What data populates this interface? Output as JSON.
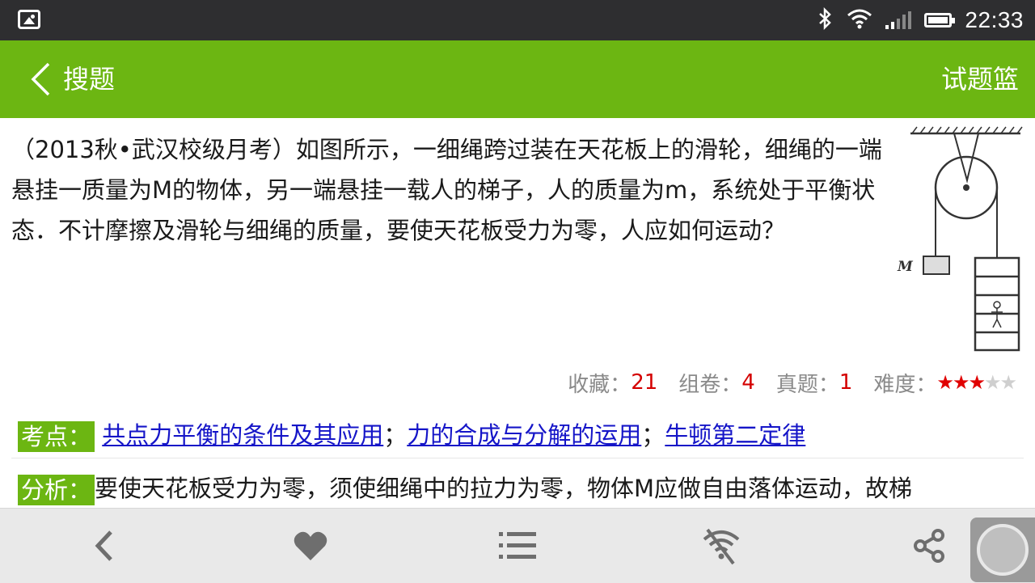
{
  "status_bar": {
    "time": "22:33"
  },
  "top_bar": {
    "back_label": "搜题",
    "right_label": "试题篮"
  },
  "question": {
    "text": "（2013秋•武汉校级月考）如图所示，一细绳跨过装在天花板上的滑轮，细绳的一端悬挂一质量为M的物体，另一端悬挂一载人的梯子，人的质量为m，系统处于平衡状态．不计摩擦及滑轮与细绳的质量，要使天花板受力为零，人应如何运动？",
    "diagram_label": "M"
  },
  "meta": {
    "collect_label": "收藏：",
    "collect_count": "21",
    "compose_label": "组卷：",
    "compose_count": "4",
    "real_label": "真题：",
    "real_count": "1",
    "difficulty_label": "难度：",
    "difficulty_stars": 3,
    "difficulty_max": 5
  },
  "kaodian": {
    "label": "考点：",
    "links": [
      "共点力平衡的条件及其应用",
      "力的合成与分解的运用",
      "牛顿第二定律"
    ],
    "separator": "；"
  },
  "fenxi": {
    "label": "分析：",
    "text": "要使天花板受力为零，须使细绳中的拉力为零，物体M应做自由落体运动，故梯"
  },
  "bottom_bar": {
    "icons": [
      "back-icon",
      "heart-icon",
      "list-icon",
      "no-wifi-icon",
      "share-icon"
    ]
  },
  "colors": {
    "primary_green": "#6cb612",
    "link_blue": "#1515c8",
    "count_red": "#d40000",
    "status_dark": "#2e2e30"
  }
}
